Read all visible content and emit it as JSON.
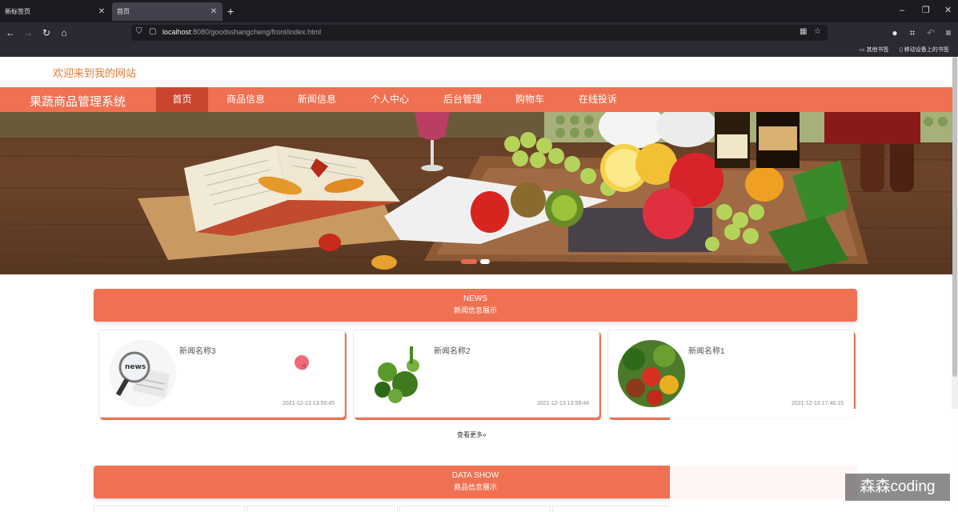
{
  "browser": {
    "tabs": [
      {
        "label": "新标签页"
      },
      {
        "label": "首页"
      }
    ],
    "new_tab": "+",
    "window_controls": {
      "minimize": "–",
      "restore": "❐",
      "close": "✕"
    },
    "url_host": "localhost",
    "url_rest": ":8080/goodsshangcheng/front/index.html",
    "bookmarks": [
      {
        "label": "其他书签"
      },
      {
        "label": "移动设备上的书签"
      }
    ]
  },
  "page": {
    "welcome": "欢迎来到我的网站",
    "brand": "果蔬商品管理系统",
    "menu": [
      {
        "label": "首页",
        "active": true
      },
      {
        "label": "商品信息"
      },
      {
        "label": "新闻信息"
      },
      {
        "label": "个人中心"
      },
      {
        "label": "后台管理"
      },
      {
        "label": "购物车"
      },
      {
        "label": "在线投诉"
      }
    ],
    "banner": {
      "alt": "果蔬 banner",
      "slide_index": 1,
      "slide_count": 2
    },
    "news_section": {
      "en": "NEWS",
      "cn": "新闻信息展示"
    },
    "news": [
      {
        "title": "新闻名称3",
        "time": "2021-12-13 13:59:45",
        "thumb": "news-magnifier-icon"
      },
      {
        "title": "新闻名称2",
        "time": "2021-12-13 13:59:44",
        "thumb": "vegetables-image"
      },
      {
        "title": "新闻名称1",
        "time": "2021-12-13 17:46:15",
        "thumb": "vegetables-basket-image"
      }
    ],
    "more_link": "查看更多»",
    "data_section": {
      "en": "DATA SHOW",
      "cn": "商品信息展示"
    }
  },
  "watermark": "森森coding",
  "colors": {
    "accent": "#f07052",
    "accent_dark": "#c9452f",
    "welcome": "#e07b33"
  }
}
